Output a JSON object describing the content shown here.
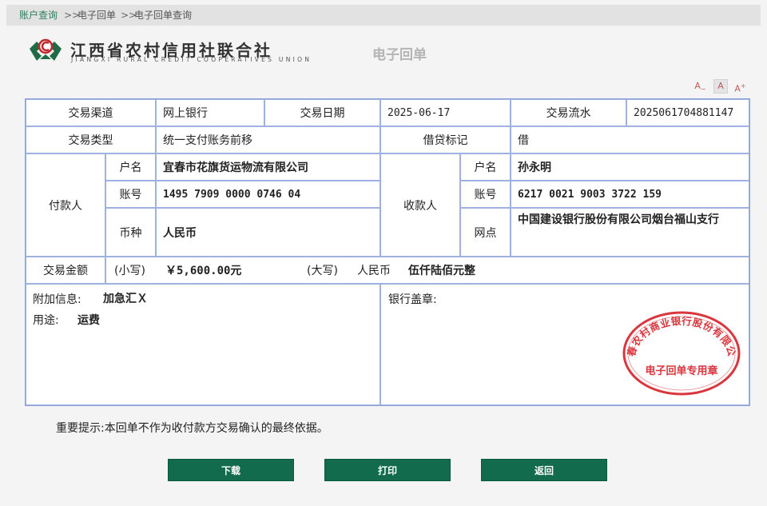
{
  "breadcrumb": {
    "items": [
      "账户查询",
      "电子回单",
      "电子回单查询"
    ],
    "separator": ">>"
  },
  "header": {
    "bank_name_cn": "江西省农村信用社联合社",
    "bank_name_en": "JIANGXI RURAL CREDIT COOPERATIVES UNION",
    "logo_icon": "jiangxi-rcc-logo-icon",
    "doc_title": "电子回单"
  },
  "font_controls": {
    "decrease": "A",
    "normal": "A",
    "increase": "A",
    "decrease_mark": "−",
    "increase_mark": "+"
  },
  "receipt": {
    "channel_label": "交易渠道",
    "channel_value": "网上银行",
    "date_label": "交易日期",
    "date_value": "2025-06-17",
    "serial_label": "交易流水",
    "serial_value": "2025061704881147",
    "type_label": "交易类型",
    "type_value": "统一支付账务前移",
    "dc_label": "借贷标记",
    "dc_value": "借",
    "payer": {
      "label": "付款人",
      "name_label": "户名",
      "name": "宜春市花旗货运物流有限公司",
      "account_label": "账号",
      "account": "1495 7909 0000 0746 04",
      "currency_label": "币种",
      "currency": "人民币"
    },
    "payee": {
      "label": "收款人",
      "name_label": "户名",
      "name": "孙永明",
      "account_label": "账号",
      "account": "6217 0021 9003 3722 159",
      "branch_label": "网点",
      "branch": "中国建设银行股份有限公司烟台福山支行"
    },
    "amount": {
      "label": "交易金额",
      "small_label": "(小写)",
      "small_value": "￥5,600.00元",
      "big_label": "(大写)",
      "currency": "人民币",
      "big_value": "伍仟陆佰元整"
    },
    "extra_info_label": "附加信息:",
    "extra_info_value": "加急汇Ｘ",
    "purpose_label": "用途:",
    "purpose_value": "运费",
    "stamp_label": "银行盖章:",
    "seal": {
      "outer_text": "宜春农村商业银行股份有限公司",
      "inner_text": "电子回单专用章",
      "color": "#d9363e"
    }
  },
  "notice": "重要提示:本回单不作为收付款方交易确认的最终依据。",
  "buttons": {
    "download": "下载",
    "print": "打印",
    "back": "返回"
  },
  "colors": {
    "accent": "#116b4c",
    "table_border": "#9fb1df",
    "breadcrumb_link": "#2e7d5b"
  }
}
